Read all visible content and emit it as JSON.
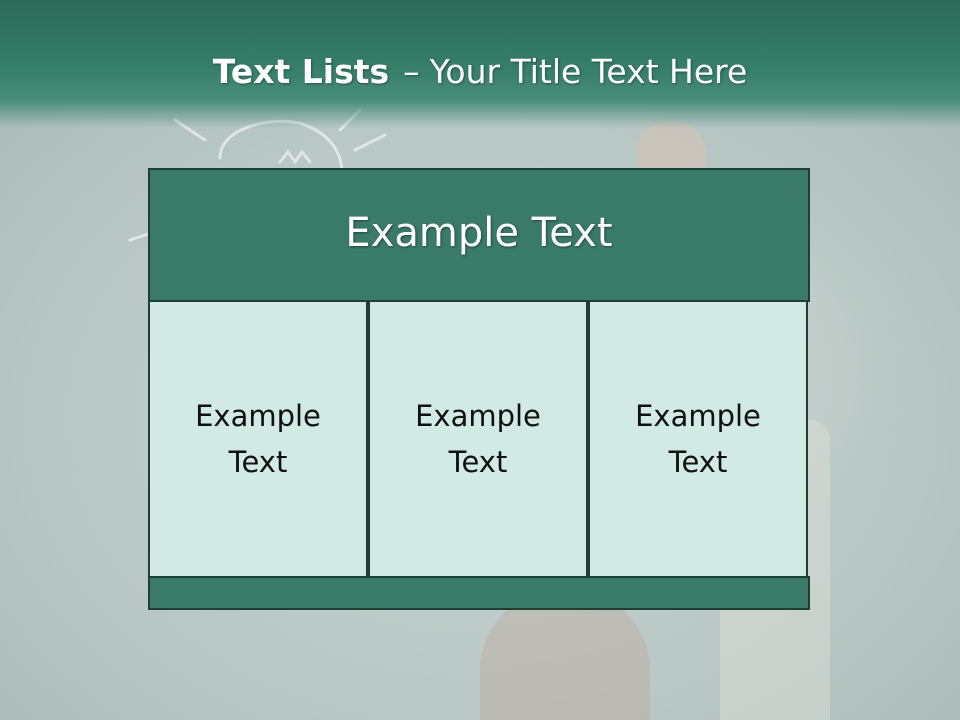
{
  "slide": {
    "title_bold": "Text Lists",
    "title_sep": "–",
    "title_rest": "Your Title Text Here"
  },
  "table": {
    "header": "Example Text",
    "columns": [
      {
        "text": "Example Text"
      },
      {
        "text": "Example Text"
      },
      {
        "text": "Example Text"
      }
    ]
  },
  "colors": {
    "title_bar": "#367f69",
    "header_fill": "#3a7a68",
    "cell_fill": "#d2eae4",
    "border": "#1f3f35"
  }
}
